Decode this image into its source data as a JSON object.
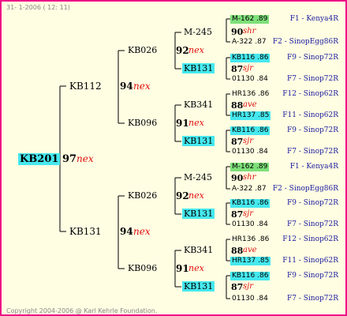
{
  "header": {
    "date_text": "31- 1-2006 ( 12: 11)"
  },
  "footer": {
    "copyright": "Copyright 2004-2006 @ Karl Kehrle Foundation."
  },
  "colors": {
    "frame": "#ee1188",
    "background": "#fffde2",
    "highlight_cyan": "#45e8ee",
    "highlight_green": "#7ee07a",
    "mating_text": "#e01010",
    "origin_text": "#1a1aa0"
  },
  "root": {
    "name": "KB201",
    "num": "97",
    "tag": "nex"
  },
  "gen1": [
    {
      "name": "KB112",
      "num": "94",
      "tag": "nex"
    },
    {
      "name": "KB131",
      "num": "94",
      "tag": "nex"
    }
  ],
  "gen2": [
    {
      "name": "KB026",
      "num": "92",
      "tag": "nex"
    },
    {
      "name": "KB096",
      "num": "91",
      "tag": "nex"
    },
    {
      "name": "KB026",
      "num": "92",
      "tag": "nex"
    },
    {
      "name": "KB096",
      "num": "91",
      "tag": "nex"
    }
  ],
  "gen3": [
    {
      "name": "M-245",
      "num": "90",
      "tag": "shr"
    },
    {
      "name": "KB131",
      "num": "87",
      "tag": "sjr"
    },
    {
      "name": "KB341",
      "num": "88",
      "tag": "ave"
    },
    {
      "name": "KB131",
      "num": "87",
      "tag": "sjr"
    },
    {
      "name": "M-245",
      "num": "90",
      "tag": "shr"
    },
    {
      "name": "KB131",
      "num": "87",
      "tag": "sjr"
    },
    {
      "name": "KB341",
      "num": "88",
      "tag": "ave"
    },
    {
      "name": "KB131",
      "num": "87",
      "tag": "sjr"
    }
  ],
  "gen4": [
    {
      "id": "M-162 .89",
      "origin": "F1 - Kenya4R"
    },
    {
      "id": "A-322 .87",
      "origin": "F2 - SinopEgg86R"
    },
    {
      "id": "KB116 .86",
      "origin": "F9 - Sinop72R"
    },
    {
      "id": "01130 .84",
      "origin": "F7 - Sinop72R"
    },
    {
      "id": "HR136 .86",
      "origin": "F12 - Sinop62R"
    },
    {
      "id": "HR137 .85",
      "origin": "F11 - Sinop62R"
    },
    {
      "id": "KB116 .86",
      "origin": "F9 - Sinop72R"
    },
    {
      "id": "01130 .84",
      "origin": "F7 - Sinop72R"
    },
    {
      "id": "M-162 .89",
      "origin": "F1 - Kenya4R"
    },
    {
      "id": "A-322 .87",
      "origin": "F2 - SinopEgg86R"
    },
    {
      "id": "KB116 .86",
      "origin": "F9 - Sinop72R"
    },
    {
      "id": "01130 .84",
      "origin": "F7 - Sinop72R"
    },
    {
      "id": "HR136 .86",
      "origin": "F12 - Sinop62R"
    },
    {
      "id": "HR137 .85",
      "origin": "F11 - Sinop62R"
    },
    {
      "id": "KB116 .86",
      "origin": "F9 - Sinop72R"
    },
    {
      "id": "01130 .84",
      "origin": "F7 - Sinop72R"
    }
  ]
}
